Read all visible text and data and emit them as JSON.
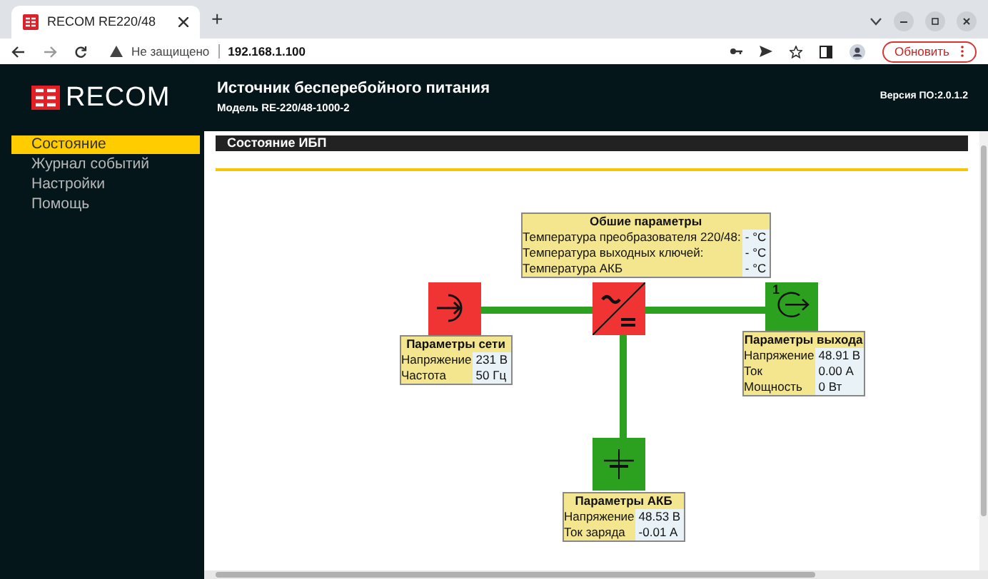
{
  "browser": {
    "tab_title": "RECOM RE220/48",
    "new_tab": "+",
    "security": "Не защищено",
    "url": "192.168.1.100",
    "update_button": "Обновить"
  },
  "header": {
    "logo": "RECOM",
    "title": "Источник бесперебойного питания",
    "model": "Модель RE-220/48-1000-2",
    "version": "Версия ПО:2.0.1.2"
  },
  "sidebar": {
    "items": [
      {
        "label": "Состояние",
        "selected": true
      },
      {
        "label": "Журнал событий",
        "selected": false
      },
      {
        "label": "Настройки",
        "selected": false
      },
      {
        "label": "Помощь",
        "selected": false
      }
    ]
  },
  "panel": {
    "title": "Состояние ИБП"
  },
  "diagram": {
    "nodes": [
      {
        "kind": "mains",
        "fault": true
      },
      {
        "kind": "inverter",
        "fault": true
      },
      {
        "kind": "output",
        "fault": false,
        "number": "1"
      },
      {
        "kind": "battery",
        "fault": false
      }
    ],
    "tables": [
      {
        "kind": "general",
        "title": "Обшие параметры",
        "rows": [
          {
            "label": "Температура преобразователя 220/48:",
            "value": "- °C"
          },
          {
            "label": "Температура выходных ключей:",
            "value": "- °C"
          },
          {
            "label": "Температура АКБ",
            "value": "- °C"
          }
        ]
      },
      {
        "kind": "mains",
        "title": "Параметры сети",
        "rows": [
          {
            "label": "Напряжение",
            "value": "231 В"
          },
          {
            "label": "Частота",
            "value": "50 Гц"
          }
        ]
      },
      {
        "kind": "output",
        "title": "Параметры выхода",
        "rows": [
          {
            "label": "Напряжение",
            "value": "48.91 В"
          },
          {
            "label": "Ток",
            "value": "0.00 А"
          },
          {
            "label": "Мощность",
            "value": "0 Вт"
          }
        ]
      },
      {
        "kind": "battery",
        "title": "Параметры АКБ",
        "rows": [
          {
            "label": "Напряжение",
            "value": "48.53 В"
          },
          {
            "label": "Ток заряда",
            "value": "-0.01 А"
          }
        ]
      }
    ]
  }
}
